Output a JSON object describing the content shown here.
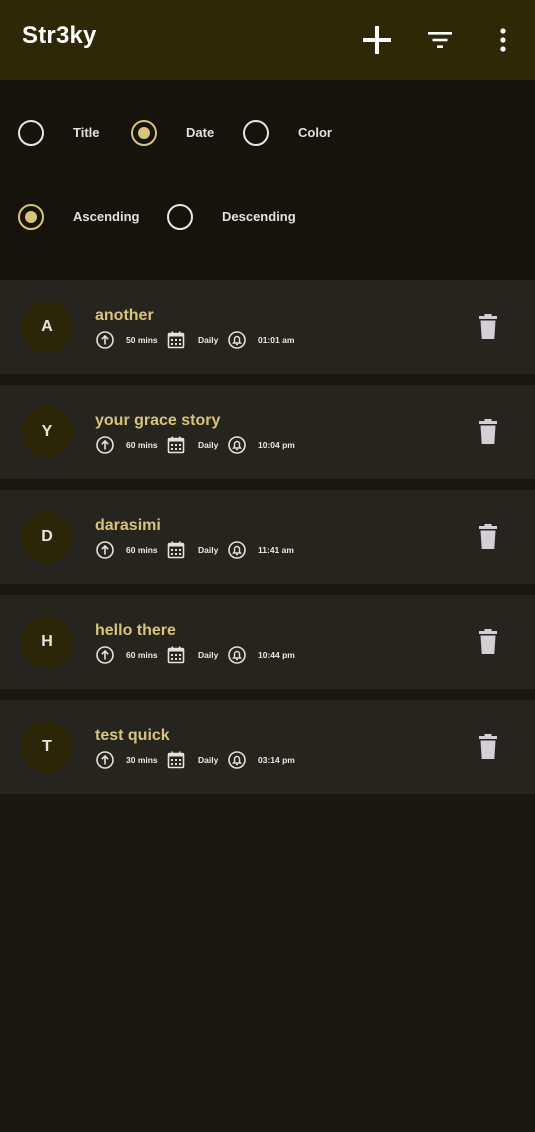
{
  "app": {
    "title": "Str3ky"
  },
  "toolbar": {
    "add_icon": "plus-icon",
    "filter_icon": "filter-icon",
    "more_icon": "more-vertical-icon"
  },
  "sort_options": {
    "sort_by": [
      {
        "label": "Title",
        "selected": false
      },
      {
        "label": "Date",
        "selected": true
      },
      {
        "label": "Color",
        "selected": false
      }
    ],
    "order": [
      {
        "label": "Ascending",
        "selected": true
      },
      {
        "label": "Descending",
        "selected": false
      }
    ],
    "accent_color": "#d7c37a"
  },
  "habits": [
    {
      "initial": "A",
      "title": "another",
      "duration": "50 mins",
      "frequency": "Daily",
      "reminder": "01:01 am"
    },
    {
      "initial": "Y",
      "title": "your grace story",
      "duration": "60 mins",
      "frequency": "Daily",
      "reminder": "10:04 pm"
    },
    {
      "initial": "D",
      "title": "darasimi",
      "duration": "60 mins",
      "frequency": "Daily",
      "reminder": "11:41 am"
    },
    {
      "initial": "H",
      "title": "hello there",
      "duration": "60 mins",
      "frequency": "Daily",
      "reminder": "10:44 pm"
    },
    {
      "initial": "T",
      "title": "test quick",
      "duration": "30 mins",
      "frequency": "Daily",
      "reminder": "03:14 pm"
    }
  ]
}
